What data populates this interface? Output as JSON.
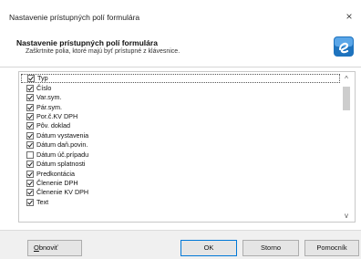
{
  "window": {
    "title": "Nastavenie prístupných polí formulára",
    "close_glyph": "×"
  },
  "header": {
    "title": "Nastavenie prístupných polí formulára",
    "subtitle": "Zaškrtnite polia, ktoré majú byť prístupné z klávesnice.",
    "logo_icon": "app-logo-icon",
    "logo_color": "#1e73be"
  },
  "fields": [
    {
      "label": "Typ",
      "checked": true,
      "selected": true
    },
    {
      "label": "Číslo",
      "checked": true
    },
    {
      "label": "Var.sym.",
      "checked": true
    },
    {
      "label": "Pár.sym.",
      "checked": true
    },
    {
      "label": "Por.č.KV DPH",
      "checked": true
    },
    {
      "label": "Pôv. doklad",
      "checked": true
    },
    {
      "label": "Dátum vystavenia",
      "checked": true
    },
    {
      "label": "Dátum daň.povin.",
      "checked": true
    },
    {
      "label": "Dátum úč.prípadu",
      "checked": false
    },
    {
      "label": "Dátum splatnosti",
      "checked": true
    },
    {
      "label": "Predkontácia",
      "checked": true
    },
    {
      "label": "Členenie DPH",
      "checked": true
    },
    {
      "label": "Členenie KV DPH",
      "checked": true
    },
    {
      "label": "Text",
      "checked": true
    }
  ],
  "scrollbar": {
    "up_glyph": "^",
    "down_glyph": "v"
  },
  "buttons": {
    "obnovit_first": "O",
    "obnovit_rest": "bnoviť",
    "ok": "OK",
    "storno": "Storno",
    "pomocnik": "Pomocník"
  }
}
